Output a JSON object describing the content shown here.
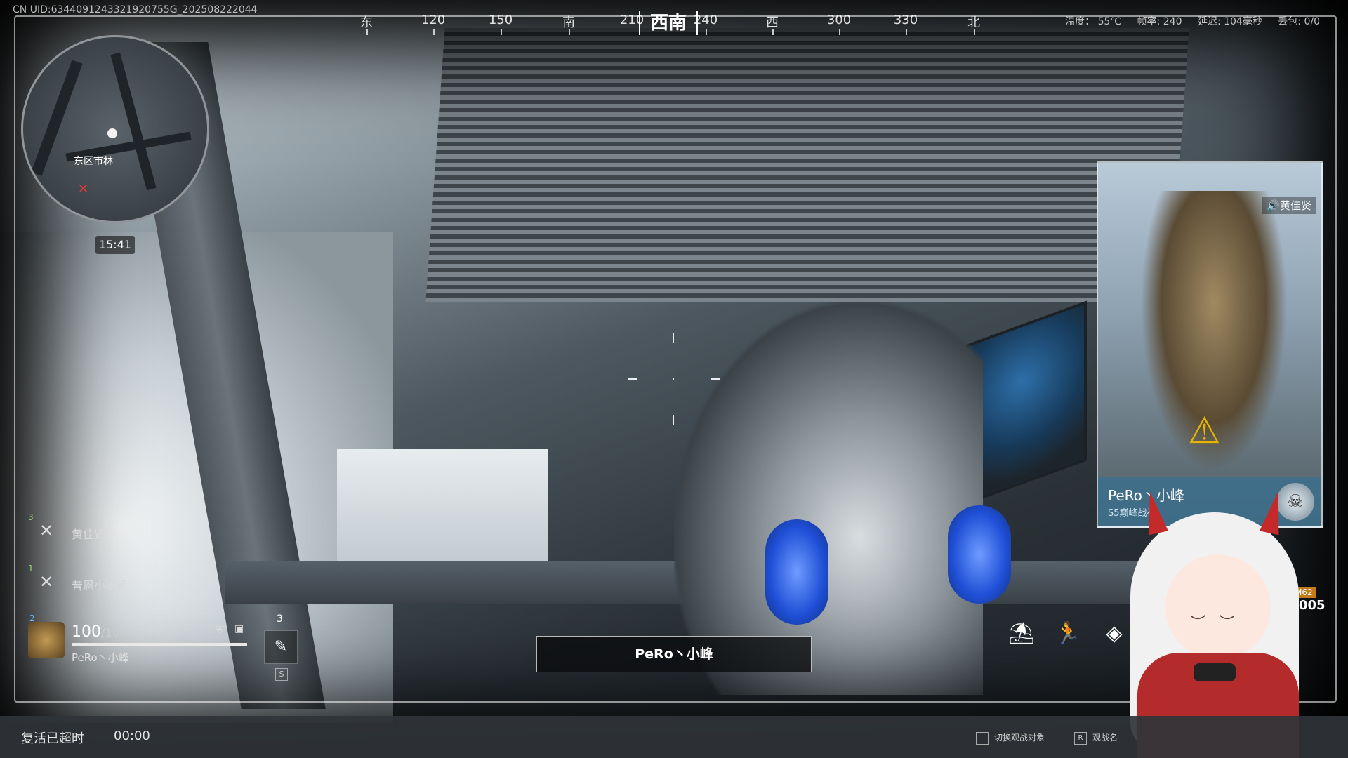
{
  "uid": "CN UID:6344091243321920755G_202508222044",
  "compass": {
    "labels": [
      "东",
      "120",
      "150",
      "南",
      "210",
      "240",
      "西",
      "300",
      "330",
      "北"
    ],
    "heading": "西南"
  },
  "status": {
    "temp": "温度： 55℃",
    "fps": "帧率: 240",
    "latency": "延迟: 104毫秒",
    "loss": "丢包: 0/0"
  },
  "minimap": {
    "area_label": "东区市林",
    "marker": "✕"
  },
  "timer": "15:41",
  "killfeed": [
    {
      "slot": "3",
      "name": "黄佳贤"
    },
    {
      "slot": "1",
      "name": "昔恩小姐姐"
    }
  ],
  "player": {
    "slot": "2",
    "hp": "100",
    "hp_max": "/100",
    "hp_fraction": 1.0,
    "name": "PeRo丶小峰"
  },
  "gadget": {
    "count": "3",
    "key": "S"
  },
  "spectate_name": "PeRo丶小峰",
  "card": {
    "voice": "🔊黄佳贤",
    "name": "PeRo丶小峰",
    "title": "S5巅峰战神"
  },
  "ammo": {
    "tag": "M62",
    "count": "005"
  },
  "bottom": {
    "revive_label": "复活已超时",
    "revive_time": "00:00",
    "hint1_key": "",
    "hint1_label": "切换观战对象",
    "hint2_key": "R",
    "hint2_label": "观战名"
  },
  "colors": {
    "accent": "#6fb6ff",
    "enemy": "#e23a3a",
    "warn": "#e6b400",
    "card_footer": "#3c6e8c"
  },
  "icons": {
    "armor": "shield-icon",
    "backpack": "bag-icon",
    "gadget": "syringe-icon",
    "action1": "parachute-icon",
    "action2": "runner-icon",
    "action3": "gadget-icon"
  }
}
